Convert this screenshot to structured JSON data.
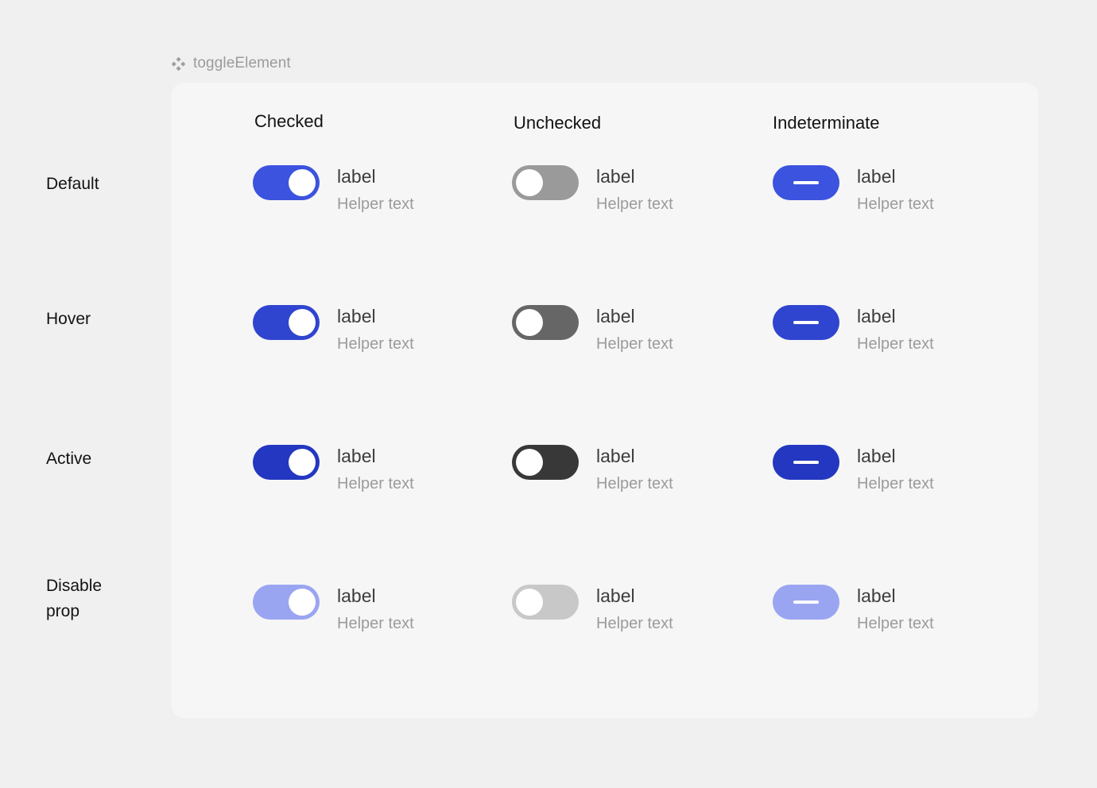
{
  "component": {
    "icon": "figma-component-icon",
    "name": "toggleElement"
  },
  "colors": {
    "page_background": "#f0f0f0",
    "card_background": "#f6f6f6",
    "label_text": "#3c3c3c",
    "helper_text": "#9b9b9b",
    "header_text": "#121212",
    "knob": "#ffffff",
    "checked_default": "#3b53de",
    "checked_hover": "#2f45cf",
    "checked_active": "#2337c0",
    "checked_disabled": "#9aa5f2",
    "unchecked_default": "#9a9a9a",
    "unchecked_hover": "#666666",
    "unchecked_active": "#383838",
    "unchecked_disabled": "#c8c8c8",
    "indeterminate_default": "#3b53de",
    "indeterminate_hover": "#2f45cf",
    "indeterminate_active": "#2337c0",
    "indeterminate_disabled": "#9aa5f2"
  },
  "columns": [
    {
      "header": "Checked"
    },
    {
      "header": "Unchecked"
    },
    {
      "header": "Indeterminate"
    }
  ],
  "rows": [
    {
      "label": "Default"
    },
    {
      "label": "Hover"
    },
    {
      "label": "Active"
    },
    {
      "label": "Disable\nprop"
    }
  ],
  "cells": [
    {
      "row": "Default",
      "column": "Checked",
      "state": "checked",
      "track_color": "#3b53de",
      "knob_position": "right",
      "label": "label",
      "helper": "Helper text"
    },
    {
      "row": "Default",
      "column": "Unchecked",
      "state": "unchecked",
      "track_color": "#9a9a9a",
      "knob_position": "left",
      "label": "label",
      "helper": "Helper text"
    },
    {
      "row": "Default",
      "column": "Indeterminate",
      "state": "indeterminate",
      "track_color": "#3b53de",
      "knob_position": "none",
      "label": "label",
      "helper": "Helper text"
    },
    {
      "row": "Hover",
      "column": "Checked",
      "state": "checked",
      "track_color": "#2f45cf",
      "knob_position": "right",
      "label": "label",
      "helper": "Helper text"
    },
    {
      "row": "Hover",
      "column": "Unchecked",
      "state": "unchecked",
      "track_color": "#666666",
      "knob_position": "left",
      "label": "label",
      "helper": "Helper text"
    },
    {
      "row": "Hover",
      "column": "Indeterminate",
      "state": "indeterminate",
      "track_color": "#2f45cf",
      "knob_position": "none",
      "label": "label",
      "helper": "Helper text"
    },
    {
      "row": "Active",
      "column": "Checked",
      "state": "checked",
      "track_color": "#2337c0",
      "knob_position": "right",
      "label": "label",
      "helper": "Helper text"
    },
    {
      "row": "Active",
      "column": "Unchecked",
      "state": "unchecked",
      "track_color": "#383838",
      "knob_position": "left",
      "label": "label",
      "helper": "Helper text"
    },
    {
      "row": "Active",
      "column": "Indeterminate",
      "state": "indeterminate",
      "track_color": "#2337c0",
      "knob_position": "none",
      "label": "label",
      "helper": "Helper text"
    },
    {
      "row": "Disable prop",
      "column": "Checked",
      "state": "checked",
      "track_color": "#9aa5f2",
      "knob_position": "right",
      "label": "label",
      "helper": "Helper text"
    },
    {
      "row": "Disable prop",
      "column": "Unchecked",
      "state": "unchecked",
      "track_color": "#c8c8c8",
      "knob_position": "left",
      "label": "label",
      "helper": "Helper text"
    },
    {
      "row": "Disable prop",
      "column": "Indeterminate",
      "state": "indeterminate",
      "track_color": "#9aa5f2",
      "knob_position": "none",
      "label": "label",
      "helper": "Helper text"
    }
  ]
}
